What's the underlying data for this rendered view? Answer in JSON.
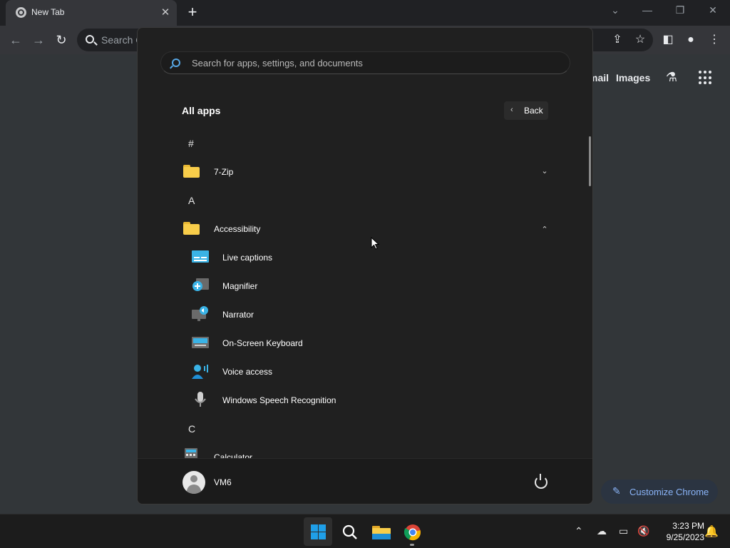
{
  "browser": {
    "tab_title": "New Tab",
    "omnibox_placeholder": "Search G",
    "ntp_links": [
      "mail",
      "Images"
    ],
    "customize_label": "Customize Chrome"
  },
  "start_menu": {
    "search_placeholder": "Search for apps, settings, and documents",
    "section_title": "All apps",
    "back_label": "Back",
    "groups": [
      {
        "letter": "#",
        "apps": [
          {
            "name": "7-Zip",
            "type": "folder",
            "expanded": false
          }
        ]
      },
      {
        "letter": "A",
        "apps": [
          {
            "name": "Accessibility",
            "type": "folder",
            "expanded": true,
            "children": [
              "Live captions",
              "Magnifier",
              "Narrator",
              "On-Screen Keyboard",
              "Voice access",
              "Windows Speech Recognition"
            ]
          }
        ]
      },
      {
        "letter": "C",
        "apps": [
          {
            "name": "Calculator",
            "type": "app"
          }
        ]
      }
    ],
    "user": {
      "name": "VM6"
    }
  },
  "taskbar": {
    "apps": [
      "start-icon",
      "search-icon",
      "file-explorer-icon",
      "chrome-icon"
    ],
    "time": "3:23 PM",
    "date": "9/25/2023"
  }
}
